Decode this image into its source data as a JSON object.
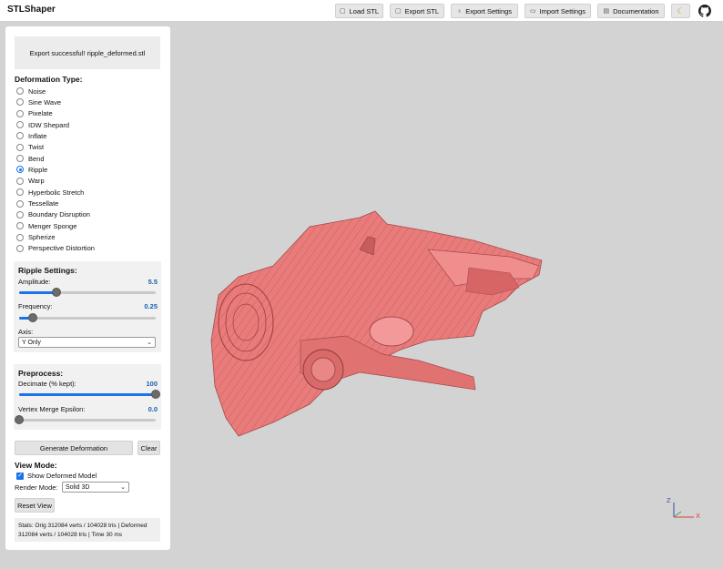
{
  "app": {
    "title": "STLShaper"
  },
  "toolbar": {
    "buttons": [
      {
        "label": "Load STL",
        "icon": "upload-icon"
      },
      {
        "label": "Export STL",
        "icon": "download-icon"
      },
      {
        "label": "Export Settings",
        "icon": "light-bulb-icon"
      },
      {
        "label": "Import Settings",
        "icon": "folder-icon"
      },
      {
        "label": "Documentation",
        "icon": "document-icon"
      }
    ],
    "theme_icon": "moon-icon",
    "github_icon": "github-icon"
  },
  "panel": {
    "status_message": "Export successful! ripple_deformed.stl",
    "deformation_title": "Deformation Type:",
    "deformation_types": [
      "Noise",
      "Sine Wave",
      "Pixelate",
      "IDW Shepard",
      "Inflate",
      "Twist",
      "Bend",
      "Ripple",
      "Warp",
      "Hyperbolic Stretch",
      "Tessellate",
      "Boundary Disruption",
      "Menger Sponge",
      "Spherize",
      "Perspective Distortion"
    ],
    "selected_deformation": "Ripple",
    "ripple": {
      "title": "Ripple Settings:",
      "amplitude_label": "Amplitude:",
      "amplitude_value": "5.5",
      "amplitude_fraction": 0.27,
      "frequency_label": "Frequency:",
      "frequency_value": "0.25",
      "frequency_fraction": 0.1,
      "axis_label": "Axis:",
      "axis_selected": "Y Only"
    },
    "preprocess": {
      "title": "Preprocess:",
      "decimate_label": "Decimate (% kept):",
      "decimate_value": "100",
      "decimate_fraction": 1.0,
      "epsilon_label": "Vertex Merge Epsilon:",
      "epsilon_value": "0.0",
      "epsilon_fraction": 0.0
    },
    "generate_label": "Generate Deformation",
    "clear_label": "Clear",
    "view_mode_title": "View Mode:",
    "show_deformed_label": "Show Deformed Model",
    "show_deformed_checked": true,
    "render_mode_label": "Render Mode:",
    "render_mode_selected": "Solid 3D",
    "reset_view_label": "Reset View",
    "stats": "Stats: Orig 312084 verts / 104028 tris | Deformed 312084 verts / 104028 tris | Time 30 ms"
  },
  "viewport": {
    "axis_x_label": "X",
    "axis_z_label": "Z",
    "model_color": "#e97b7b"
  },
  "colors": {
    "accent": "#1a73e8",
    "value": "#1a5fb4"
  }
}
